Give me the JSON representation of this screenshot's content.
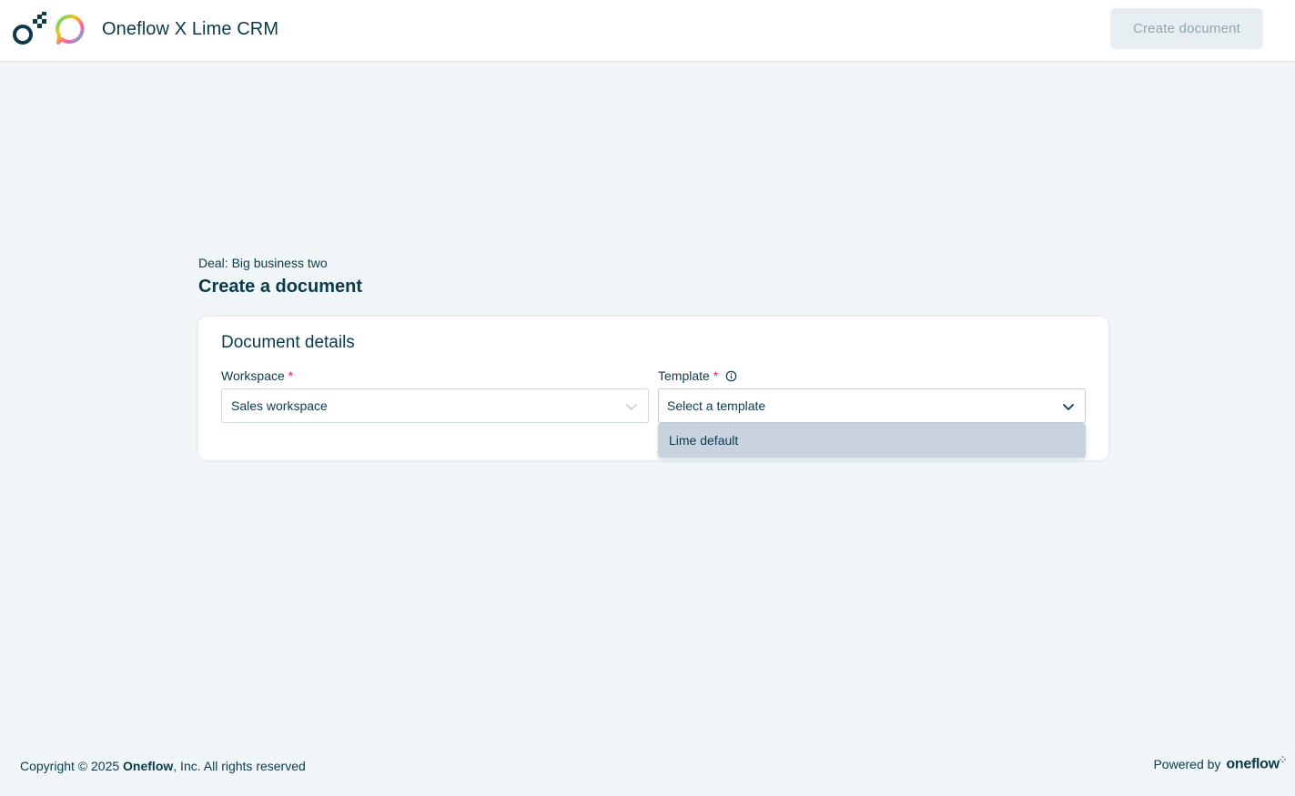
{
  "header": {
    "app_title": "Oneflow X Lime CRM",
    "create_button_label": "Create document"
  },
  "page": {
    "deal_label": "Deal: Big business two",
    "title": "Create a document"
  },
  "card": {
    "title": "Document details",
    "workspace": {
      "label": "Workspace",
      "required_mark": "*",
      "value": "Sales workspace"
    },
    "template": {
      "label": "Template",
      "required_mark": "*",
      "placeholder": "Select a template",
      "options": [
        "Lime default"
      ]
    }
  },
  "footer": {
    "copyright_prefix": "Copyright © 2025 ",
    "brand": "Oneflow",
    "copyright_suffix": ", Inc. All rights reserved",
    "powered_by": "Powered by",
    "powered_logo": "oneflow"
  },
  "colors": {
    "primary_text": "#0c3a4a",
    "required": "#e0245e",
    "background": "#f0f6f7",
    "option_highlight": "#c8d3df"
  },
  "icons": [
    "oneflow-logo-icon",
    "lime-logo-icon",
    "chevron-down-icon",
    "info-icon"
  ]
}
